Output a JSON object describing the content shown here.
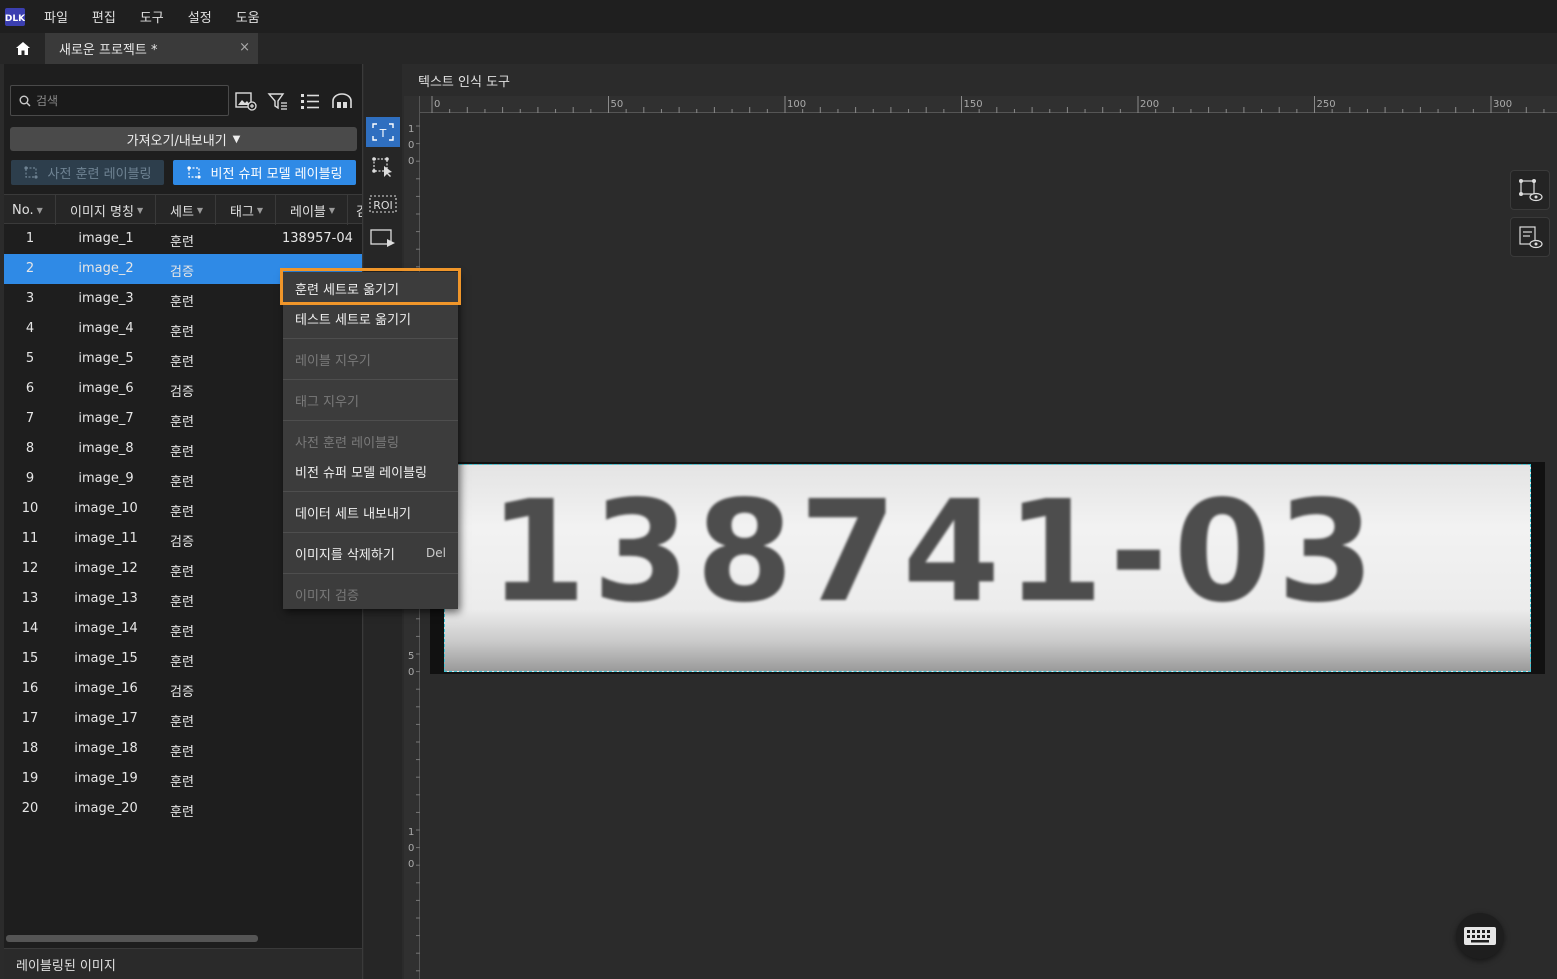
{
  "menubar": {
    "logo_text": "DLK",
    "items": [
      "파일",
      "편집",
      "도구",
      "설정",
      "도움"
    ]
  },
  "tabs": {
    "doc_tab": "새로운 프로젝트 *",
    "close": "×"
  },
  "left_panel": {
    "search_placeholder": "검색",
    "import_export": "가져오기/내보내기",
    "pretrained_labeling": "사전 훈련 레이블링",
    "vision_labeling": "비전 슈퍼 모델 레이블링",
    "columns": [
      "No.",
      "이미지 명칭",
      "세트",
      "태그",
      "레이블",
      "검"
    ],
    "rows": [
      {
        "no": "1",
        "name": "image_1",
        "set": "훈련",
        "label": "138957-04"
      },
      {
        "no": "2",
        "name": "image_2",
        "set": "검증",
        "label": ""
      },
      {
        "no": "3",
        "name": "image_3",
        "set": "훈련",
        "label": ""
      },
      {
        "no": "4",
        "name": "image_4",
        "set": "훈련",
        "label": ""
      },
      {
        "no": "5",
        "name": "image_5",
        "set": "훈련",
        "label": ""
      },
      {
        "no": "6",
        "name": "image_6",
        "set": "검증",
        "label": ""
      },
      {
        "no": "7",
        "name": "image_7",
        "set": "훈련",
        "label": ""
      },
      {
        "no": "8",
        "name": "image_8",
        "set": "훈련",
        "label": ""
      },
      {
        "no": "9",
        "name": "image_9",
        "set": "훈련",
        "label": ""
      },
      {
        "no": "10",
        "name": "image_10",
        "set": "훈련",
        "label": ""
      },
      {
        "no": "11",
        "name": "image_11",
        "set": "검증",
        "label": ""
      },
      {
        "no": "12",
        "name": "image_12",
        "set": "훈련",
        "label": ""
      },
      {
        "no": "13",
        "name": "image_13",
        "set": "훈련",
        "label": ""
      },
      {
        "no": "14",
        "name": "image_14",
        "set": "훈련",
        "label": ""
      },
      {
        "no": "15",
        "name": "image_15",
        "set": "훈련",
        "label": ""
      },
      {
        "no": "16",
        "name": "image_16",
        "set": "검증",
        "label": ""
      },
      {
        "no": "17",
        "name": "image_17",
        "set": "훈련",
        "label": ""
      },
      {
        "no": "18",
        "name": "image_18",
        "set": "훈련",
        "label": ""
      },
      {
        "no": "19",
        "name": "image_19",
        "set": "훈련",
        "label": ""
      },
      {
        "no": "20",
        "name": "image_20",
        "set": "훈련",
        "label": ""
      }
    ],
    "selected_row": "2",
    "footer": "레이블링된 이미지"
  },
  "toolbar": {
    "roi_label": "ROI"
  },
  "canvas": {
    "title": "텍스트 인식 도구",
    "image_text": "138741-03",
    "ruler_top": [
      "0",
      "50",
      "100",
      "150",
      "200",
      "250",
      "300"
    ],
    "ruler_left_top": [
      "1",
      "0",
      "0"
    ],
    "ruler_left_mid": [
      "5",
      "0"
    ],
    "ruler_left_bottom": [
      "1",
      "0",
      "0"
    ]
  },
  "context_menu": {
    "items": [
      {
        "label": "훈련 세트로 옮기기",
        "enabled": true
      },
      {
        "label": "테스트 세트로 옮기기",
        "enabled": true
      },
      {
        "label": "레이블 지우기",
        "enabled": false
      },
      {
        "label": "태그 지우기",
        "enabled": false
      },
      {
        "label": "사전 훈련 레이블링",
        "enabled": false
      },
      {
        "label": "비전 슈퍼 모델 레이블링",
        "enabled": true
      },
      {
        "label": "데이터 세트 내보내기",
        "enabled": true
      },
      {
        "label": "이미지를 삭제하기",
        "enabled": true,
        "shortcut": "Del"
      },
      {
        "label": "이미지 검증",
        "enabled": false
      }
    ]
  },
  "colors": {
    "accent": "#2f8ae6",
    "highlight": "#f0962a",
    "selection_outline": "#3ec7d6"
  }
}
